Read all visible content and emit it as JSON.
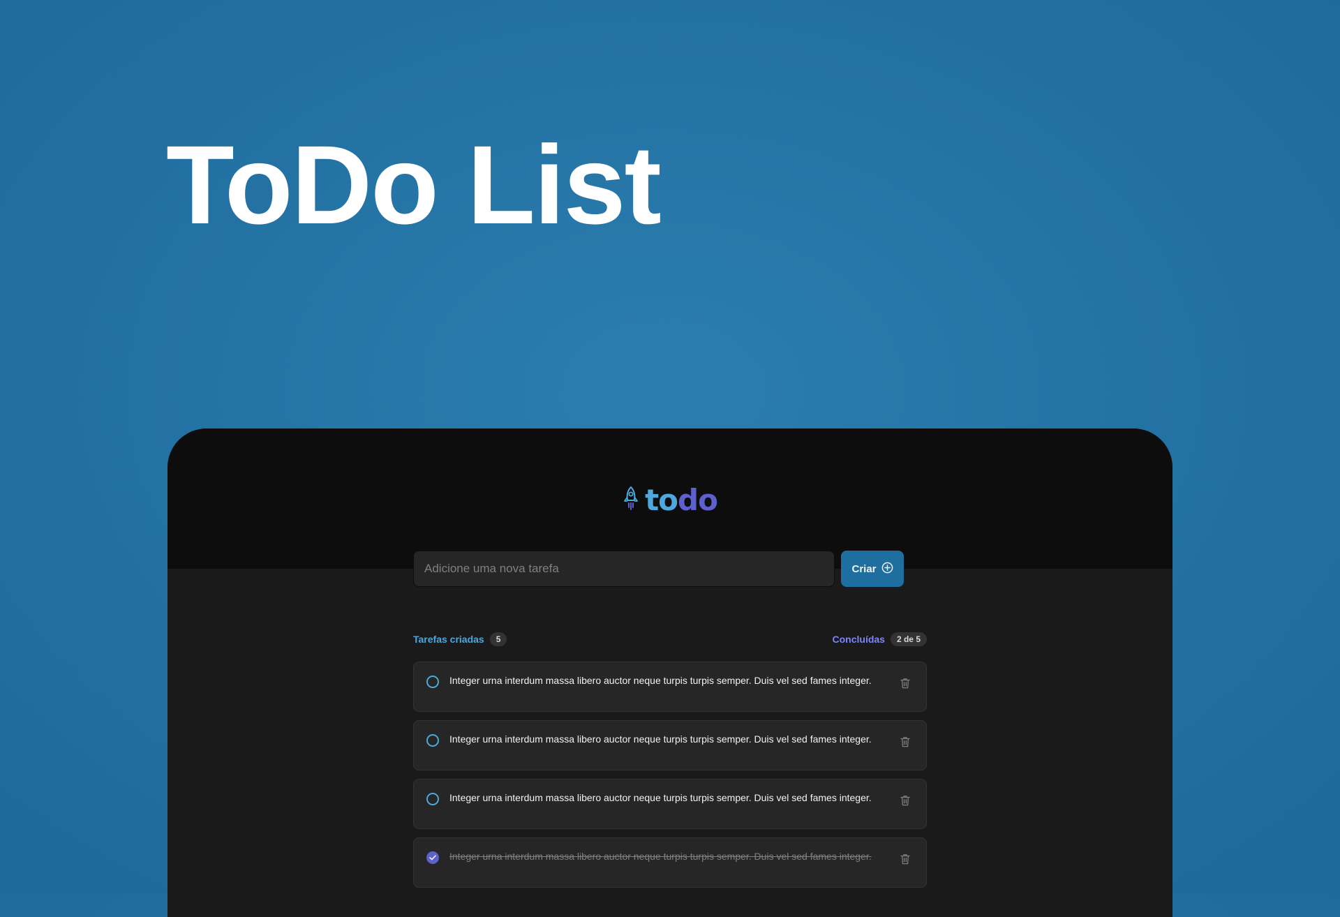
{
  "hero": {
    "title": "ToDo List"
  },
  "app": {
    "logo": {
      "icon": "rocket-icon",
      "text_to": "to",
      "text_do": "do"
    },
    "new_task": {
      "placeholder": "Adicione uma nova tarefa",
      "value": "",
      "button_label": "Criar",
      "button_icon": "plus-circle-icon"
    },
    "counters": {
      "created_label": "Tarefas criadas",
      "created_count": "5",
      "done_label": "Concluídas",
      "done_count": "2 de 5"
    },
    "tasks": [
      {
        "text": "Integer urna interdum massa libero auctor neque turpis turpis semper. Duis vel sed fames integer.",
        "done": false
      },
      {
        "text": "Integer urna interdum massa libero auctor neque turpis turpis semper. Duis vel sed fames integer.",
        "done": false
      },
      {
        "text": "Integer urna interdum massa libero auctor neque turpis turpis semper. Duis vel sed fames integer.",
        "done": false
      },
      {
        "text": "Integer urna interdum massa libero auctor neque turpis turpis semper. Duis vel sed fames integer.",
        "done": true
      }
    ]
  },
  "colors": {
    "background": "#2574a6",
    "blue": "#4ea8de",
    "blue_dark": "#1e6f9f",
    "purple": "#8284fa",
    "purple_dark": "#5e60ce",
    "gray_700": "#0d0d0d",
    "gray_600": "#1a1a1a",
    "gray_500": "#262626",
    "gray_400": "#333333",
    "gray_300": "#808080",
    "gray_100": "#f2f2f2"
  }
}
